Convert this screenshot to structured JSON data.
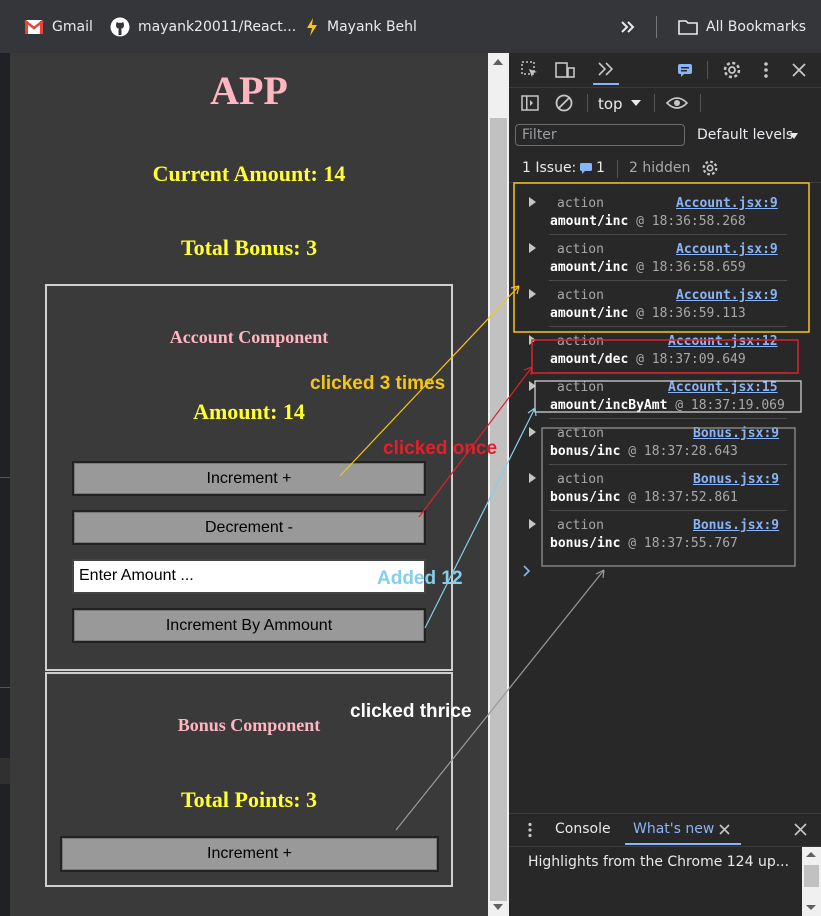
{
  "bookmarks": {
    "items": [
      {
        "label": "Gmail",
        "icon": "gmail-icon"
      },
      {
        "label": "mayank20011/React...",
        "icon": "github-icon"
      },
      {
        "label": "Mayank Behl",
        "icon": "bolt-icon"
      }
    ],
    "more_icon": "double-chevron-icon",
    "all_bookmarks": "All Bookmarks"
  },
  "app": {
    "title": "APP",
    "current_amount": "Current Amount: 14",
    "total_bonus": "Total Bonus: 3",
    "account": {
      "heading": "Account Component",
      "amount": "Amount: 14",
      "increment_label": "Increment +",
      "decrement_label": "Decrement -",
      "amount_placeholder": "Enter Amount ...",
      "increment_by_amount_label": "Increment By Ammount"
    },
    "bonus": {
      "heading": "Bonus Component",
      "total_points": "Total Points: 3",
      "increment_label": "Increment +"
    }
  },
  "devtools": {
    "context": "top",
    "filter_placeholder": "Filter",
    "levels": "Default levels",
    "issues_label": "1 Issue:",
    "issues_count": "1",
    "hidden": "2 hidden",
    "logs": [
      {
        "action": "action",
        "source": "Account.jsx:9",
        "type": "amount/inc",
        "time": "@ 18:36:58.268"
      },
      {
        "action": "action",
        "source": "Account.jsx:9",
        "type": "amount/inc",
        "time": "@ 18:36:58.659"
      },
      {
        "action": "action",
        "source": "Account.jsx:9",
        "type": "amount/inc",
        "time": "@ 18:36:59.113"
      },
      {
        "action": "action",
        "source": "Account.jsx:12",
        "type": "amount/dec",
        "time": "@ 18:37:09.649"
      },
      {
        "action": "action",
        "source": "Account.jsx:15",
        "type": "amount/incByAmt",
        "time": "@ 18:37:19.069"
      },
      {
        "action": "action",
        "source": "Bonus.jsx:9",
        "type": "bonus/inc",
        "time": "@ 18:37:28.643"
      },
      {
        "action": "action",
        "source": "Bonus.jsx:9",
        "type": "bonus/inc",
        "time": "@ 18:37:52.861"
      },
      {
        "action": "action",
        "source": "Bonus.jsx:9",
        "type": "bonus/inc",
        "time": "@ 18:37:55.767"
      }
    ],
    "drawer_tabs": [
      "Console",
      "What's new"
    ],
    "whats_new_text": "Highlights from the Chrome 124 up..."
  },
  "annotations": {
    "clicked_3": "clicked 3 times",
    "clicked_once": "clicked once",
    "added_12": "Added 12",
    "clicked_thrice": "clicked thrice",
    "colors": {
      "yellow": "#f5c518",
      "red": "#e0202a",
      "blue": "#87ceeb",
      "gray": "#9a9a9a"
    }
  }
}
